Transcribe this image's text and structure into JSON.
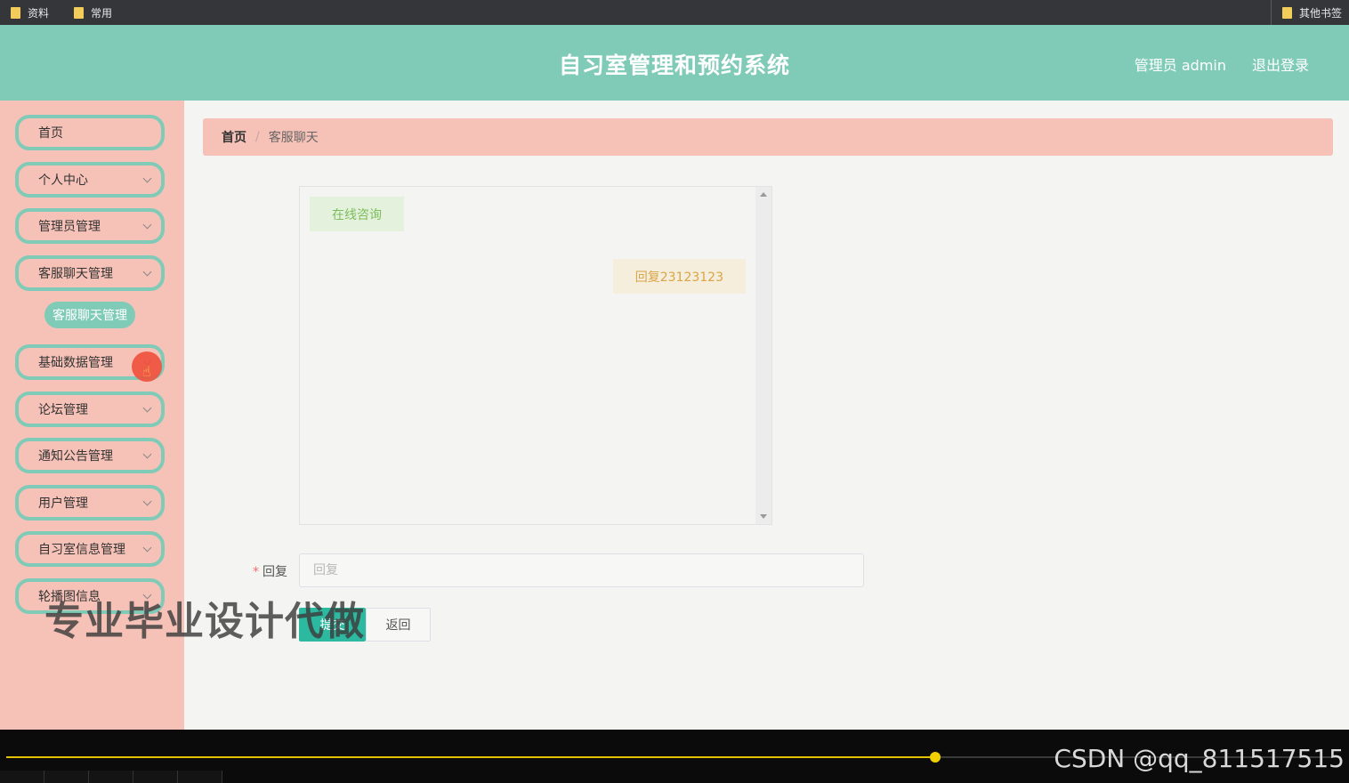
{
  "bookmarks": {
    "items": [
      "资料",
      "常用"
    ],
    "other": "其他书签"
  },
  "header": {
    "title": "自习室管理和预约系统",
    "user": "管理员 admin",
    "logout": "退出登录"
  },
  "sidebar": {
    "items": [
      {
        "label": "首页",
        "expandable": false
      },
      {
        "label": "个人中心",
        "expandable": true
      },
      {
        "label": "管理员管理",
        "expandable": true
      },
      {
        "label": "客服聊天管理",
        "expandable": true
      },
      {
        "label": "基础数据管理",
        "expandable": true
      },
      {
        "label": "论坛管理",
        "expandable": true
      },
      {
        "label": "通知公告管理",
        "expandable": true
      },
      {
        "label": "用户管理",
        "expandable": true
      },
      {
        "label": "自习室信息管理",
        "expandable": true
      },
      {
        "label": "轮播图信息",
        "expandable": true
      }
    ],
    "sub_item": "客服聊天管理"
  },
  "breadcrumb": {
    "home": "首页",
    "separator": "/",
    "current": "客服聊天"
  },
  "chat": {
    "messages": [
      {
        "side": "left",
        "text": "在线咨询"
      },
      {
        "side": "right",
        "text": "回复23123123"
      }
    ]
  },
  "form": {
    "label": "回复",
    "required_mark": "*",
    "placeholder": "回复",
    "value": "",
    "submit": "提交",
    "back": "返回"
  },
  "watermark": "专业毕业设计代做",
  "player": {
    "progress_fraction": 0.696,
    "credit": "CSDN @qq_811517515"
  },
  "colors": {
    "primary": "#80cbb7",
    "sidebar_bg": "#f6c1b7",
    "button": "#2db8a0"
  }
}
